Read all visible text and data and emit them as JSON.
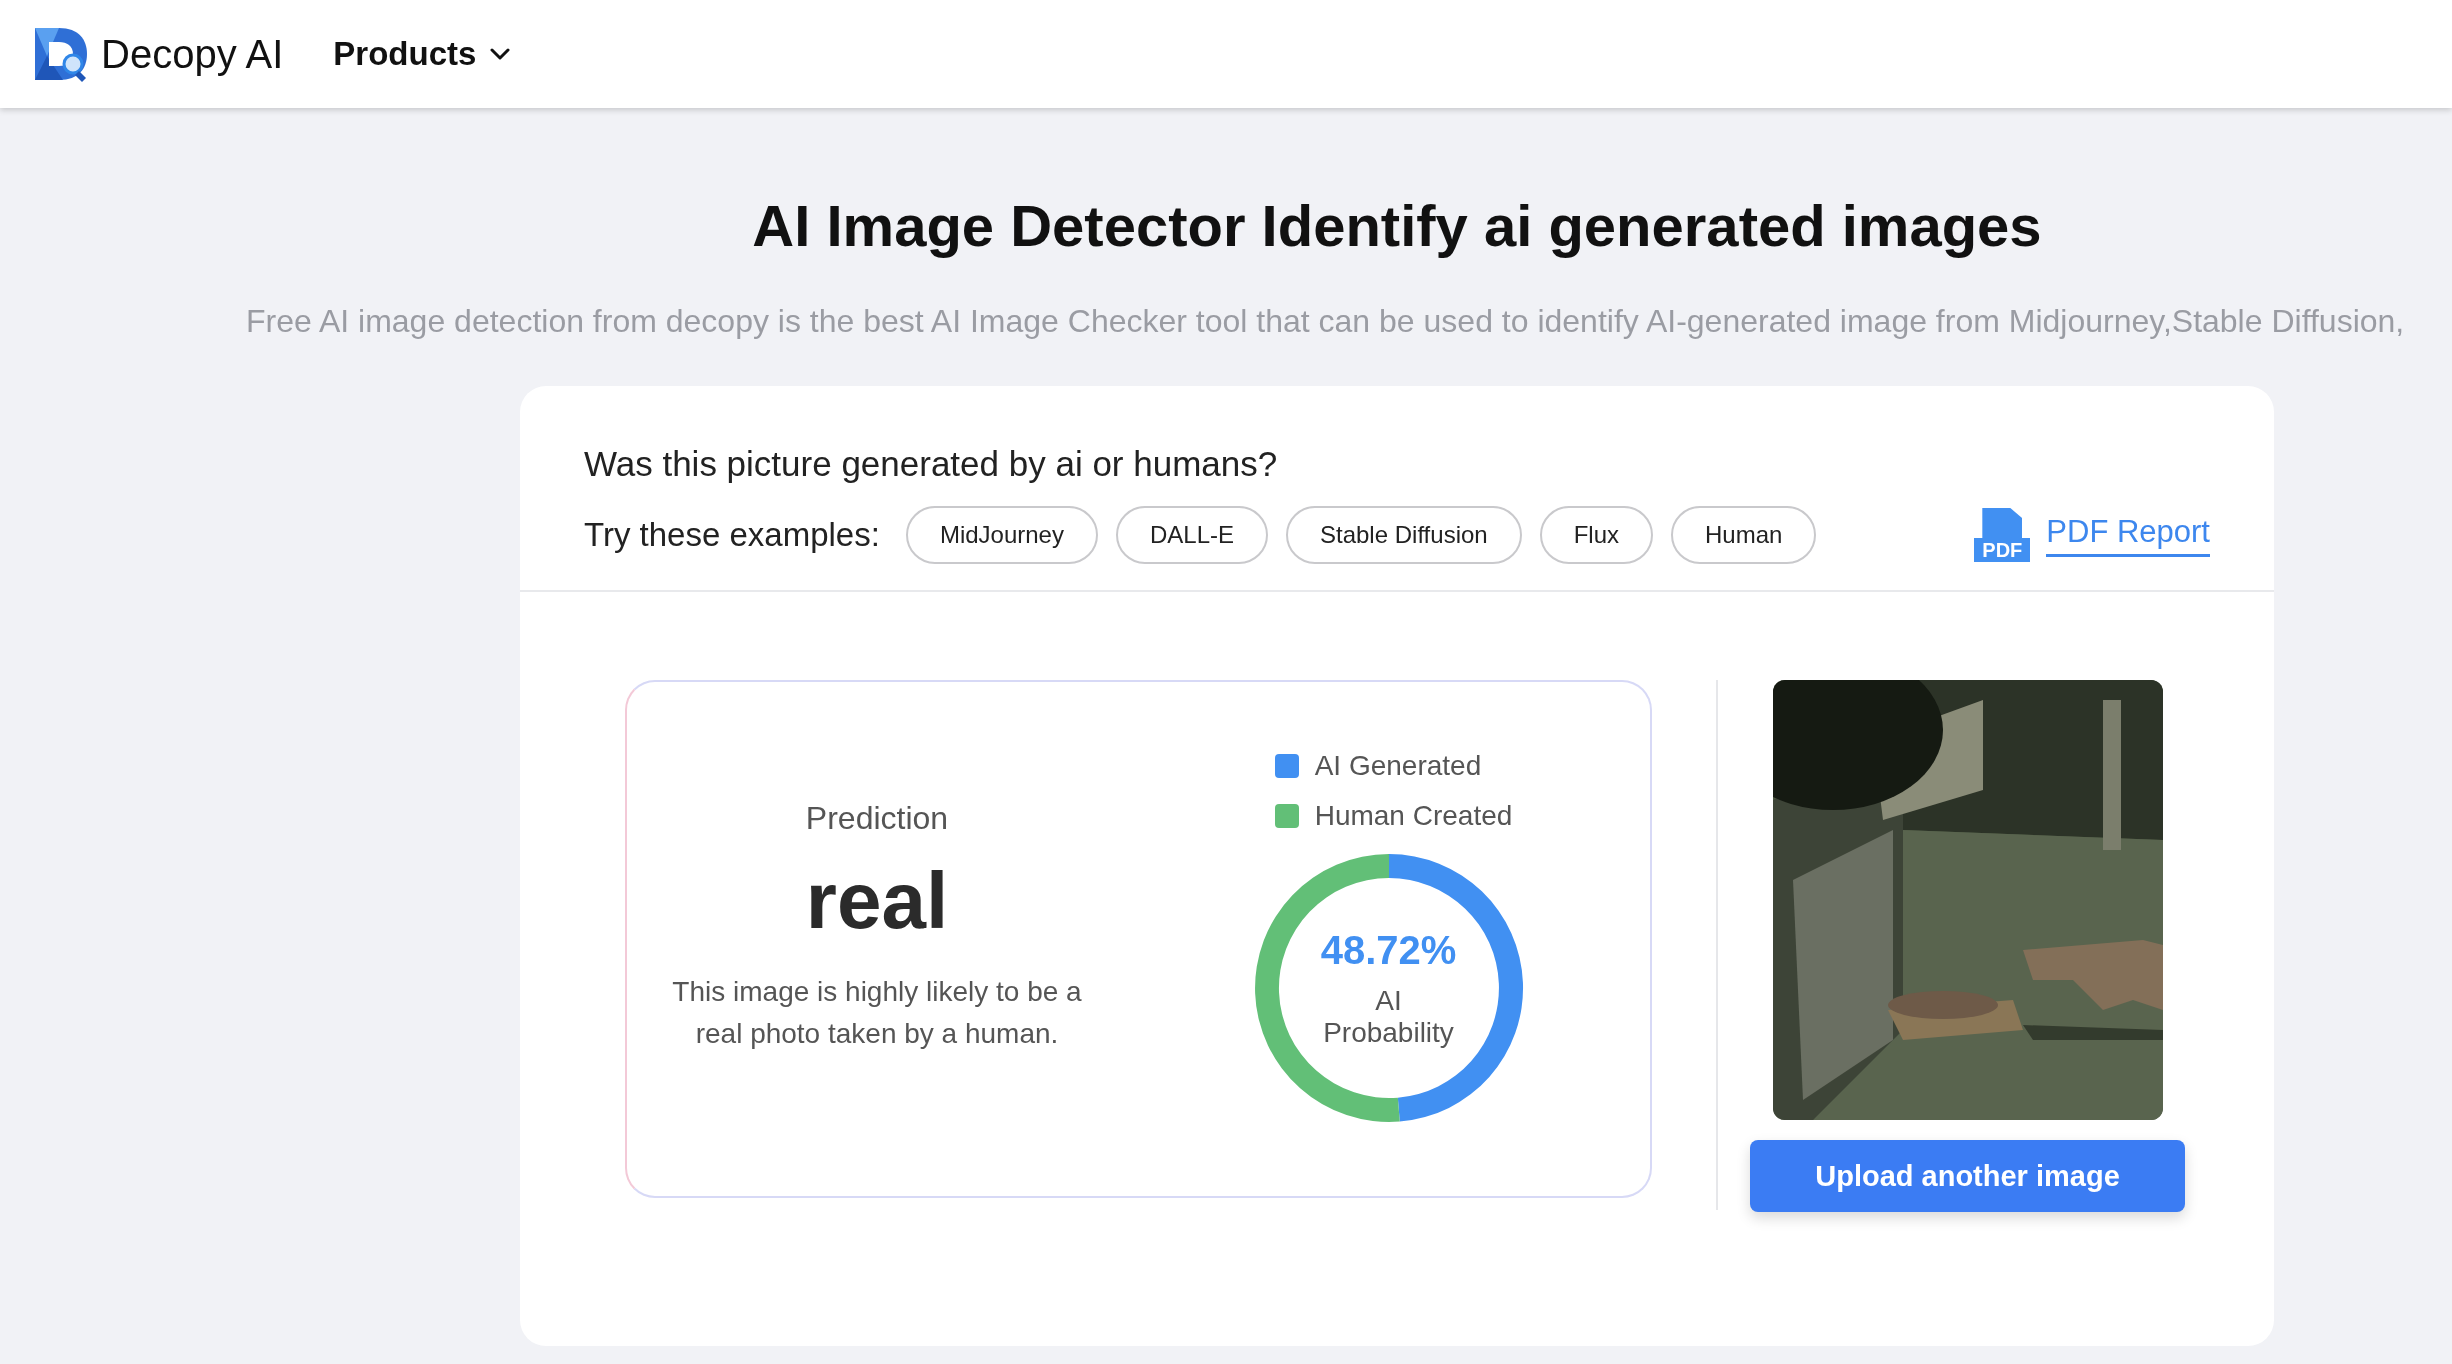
{
  "header": {
    "brand": "Decopy AI",
    "menu": [
      {
        "label": "Products",
        "has_dropdown": true
      }
    ]
  },
  "hero": {
    "title": "AI Image Detector Identify ai generated images",
    "description": "Free AI image detection from decopy is the best AI Image Checker tool that can be used to identify AI-generated image from Midjourney,Stable Diffusion,"
  },
  "detector": {
    "question": "Was this picture generated by ai or humans?",
    "examples_label": "Try these examples:",
    "examples": [
      {
        "label": "MidJourney"
      },
      {
        "label": "DALL-E"
      },
      {
        "label": "Stable Diffusion"
      },
      {
        "label": "Flux"
      },
      {
        "label": "Human"
      }
    ],
    "report_link": {
      "icon_text": "PDF",
      "label": "PDF Report"
    },
    "result": {
      "heading": "Prediction",
      "verdict": "real",
      "explanation": "This image is highly likely to be a real photo taken by a human.",
      "chart_data": {
        "type": "donut",
        "categories": [
          "AI Generated",
          "Human Created"
        ],
        "values": [
          48.72,
          51.28
        ],
        "colors": [
          "#4190f2",
          "#62bf77"
        ]
      },
      "center_value": "48.72%",
      "center_label": "AI Probability"
    },
    "upload_button": "Upload another image"
  }
}
